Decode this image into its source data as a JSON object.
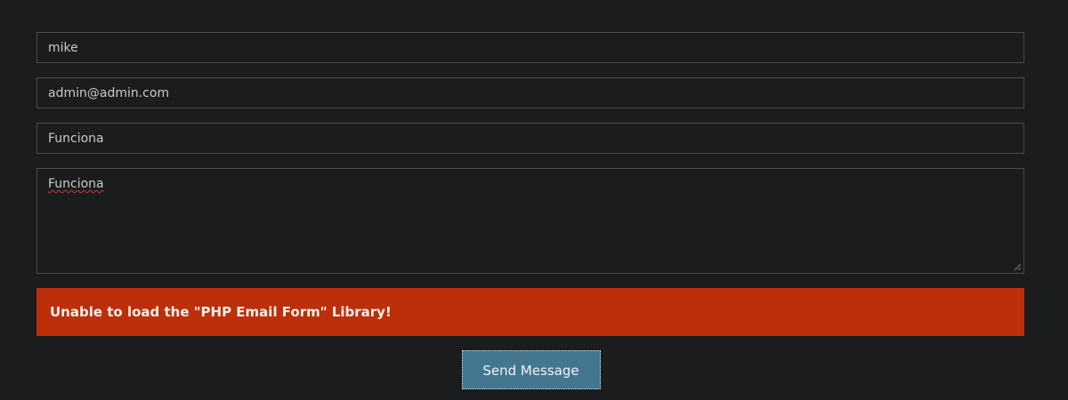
{
  "form": {
    "name_value": "mike",
    "email_value": "admin@admin.com",
    "subject_value": "Funciona",
    "message_value": "Funciona",
    "error_message": "Unable to load the \"PHP Email Form\" Library!",
    "submit_label": "Send Message"
  },
  "colors": {
    "background": "#1b1c1e",
    "field_border": "#4a4b4d",
    "error_background": "#bc2f0a",
    "submit_background": "#43768f"
  }
}
